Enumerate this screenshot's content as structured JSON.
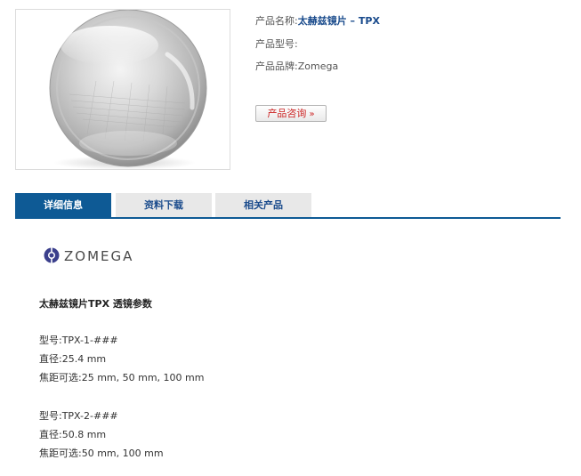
{
  "product": {
    "name_label": "产品名称:",
    "name_value": "太赫兹镜片 – TPX",
    "model_label": "产品型号:",
    "model_value": "",
    "brand_label": "产品品牌:",
    "brand_value": "Zomega",
    "inquiry_label": "产品咨询",
    "inquiry_icon": "»"
  },
  "tabs": [
    {
      "label": "详细信息",
      "active": true
    },
    {
      "label": "资料下载",
      "active": false
    },
    {
      "label": "相关产品",
      "active": false
    }
  ],
  "logo": {
    "text": "ZOMEGA"
  },
  "details": {
    "title": "太赫兹镜片TPX 透镜参数",
    "groups": [
      {
        "model": "型号:TPX-1-###",
        "diameter": "直径:25.4 mm",
        "focal": "焦距可选:25 mm, 50 mm, 100 mm"
      },
      {
        "model": "型号:TPX-2-###",
        "diameter": "直径:50.8 mm",
        "focal": "焦距可选:50 mm, 100 mm"
      }
    ]
  },
  "colors": {
    "accent": "#0e5a95",
    "link": "#1a4b8c",
    "button_text": "#cc2222",
    "tab_inactive": "#e8e8e8"
  }
}
